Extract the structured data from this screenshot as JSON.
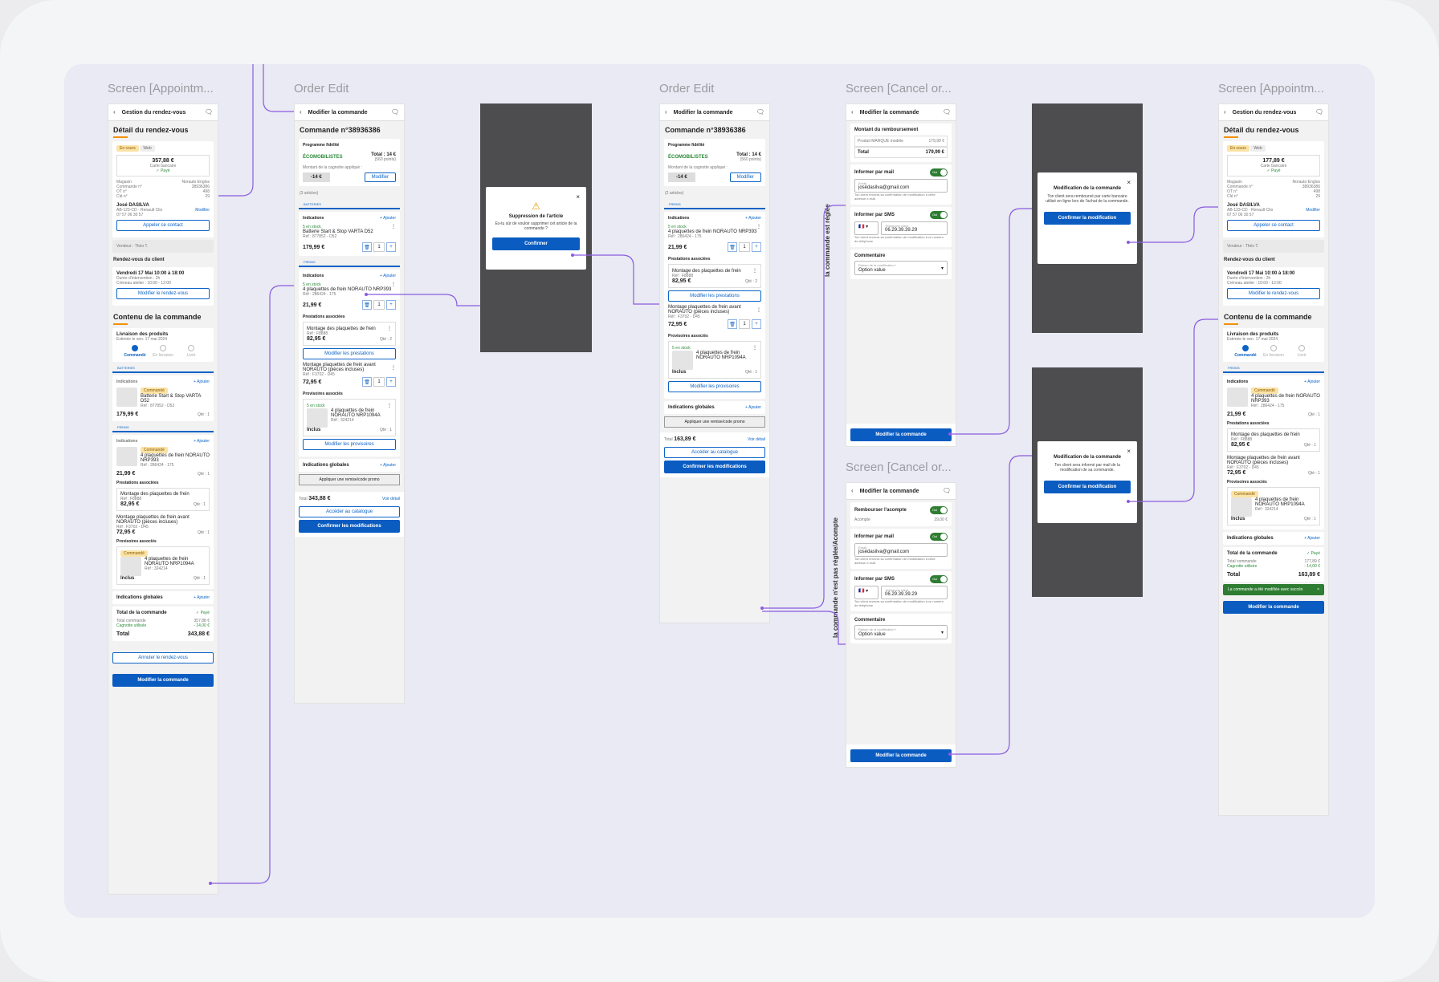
{
  "frames": {
    "s1": "Screen [Appointm...",
    "s2": "Order Edit",
    "s3": "Order Edit",
    "s4": "Screen [Cancel or...",
    "s5": "Screen [Cancel or...",
    "s6": "Screen [Appointm..."
  },
  "flow_labels": {
    "settled": "la commande est réglée",
    "not_settled": "la commande n'est pas réglée/Acompte"
  },
  "appt": {
    "topbar": "Gestion du rendez-vous",
    "detail_title": "Détail du rendez-vous",
    "badge_status": "En cours",
    "badge_channel": "Web",
    "amount": "357,88 €",
    "amount_after": "177,89 €",
    "payment": "Carte bancaire",
    "paid": "✓ Payé",
    "info": [
      {
        "k": "Magasin",
        "v": "Norauto Englos"
      },
      {
        "k": "Commande n°",
        "v": "38936386"
      },
      {
        "k": "OT n°",
        "v": "498"
      },
      {
        "k": "Clé n°",
        "v": "29"
      }
    ],
    "client_name": "José DASILVA",
    "vehicle": "AB-123-CD · Renault Clio",
    "modify": "Modifier",
    "phone": "07 57 06 30 57",
    "call_btn": "Appeler ce contact",
    "seller": "Vendeur : Théo T.",
    "rdv_title": "Rendez-vous du client",
    "rdv_date": "Vendredi 17 Mai 10:00 à 18:00",
    "rdv_duration": "Durée d'intervention : 2h",
    "rdv_slot": "Créneau atelier : 10:00 - 12:00",
    "rdv_btn": "Modifier le rendez-vous",
    "content_title": "Contenu de la commande",
    "delivery_title": "Livraison des produits",
    "delivery_est": "Estimée le ven. 17 mai 2024",
    "steps": [
      "Commandé",
      "En livraison",
      "Livré"
    ],
    "section_batteries": "BATTERIES",
    "section_freins": "FREINS",
    "indications": "Indications",
    "ajouter": "+ Ajouter",
    "ordered_badge": "Commandé",
    "battery_name": "Batterie Start & Stop VARTA D52",
    "battery_ref": "Réf : 877852 - D52",
    "battery_price": "179,99 €",
    "qty1": "Qté : 1",
    "qty2": "Qté : 2",
    "pads_name": "4 plaquettes de frein NORAUTO NRP393",
    "pads_ref": "Réf : 286424 - 175",
    "pads_price": "21,99 €",
    "services_title": "Prestations associées",
    "service1": "Montage des plaquettes de frein",
    "service1_ref": "Réf : F8888",
    "service1_price": "82,95 €",
    "service2": "Montage plaquettes de frein avant NORAUTO (pièces incluses)",
    "service2_ref": "Réf : F3702 - D45",
    "service2_price": "72,95 €",
    "provisional_title": "Provisoires associés",
    "prov_name": "4 plaquettes de frein NORAUTO NRP1094A",
    "prov_ref": "Réf : 324214",
    "included": "Inclus",
    "global_ind": "Indications globales",
    "total_title": "Total de la commande",
    "paid_short": "✓ Payé",
    "total_cmd": "Total commande",
    "total_cmd_v": "357,88 €",
    "total_cmd_v2": "177,89 €",
    "cagnotte": "Cagnotte utilisée",
    "cagnotte_v": "- 14,00 €",
    "total": "Total",
    "total_v": "343,88 €",
    "total_v2": "163,89 €",
    "cancel_btn": "Annuler le rendez-vous",
    "edit_btn": "Modifier la commande",
    "toast": "La commande a été modifiée avec succès"
  },
  "order": {
    "topbar": "Modifier la commande",
    "title": "Commande n°38936386",
    "loyalty": "Programme fidélité",
    "brand": "ÉCOMOBILISTES",
    "loyalty_total": "Total : 14 €",
    "loyalty_points": "(560 points)",
    "cagnotte_label": "Montant de la cagnotte appliqué :",
    "cagnotte_value": "-14 €",
    "modify": "Modifier",
    "articles": "(3 articles)",
    "articles2": "(2 articles)",
    "in_stock": "5 en stock",
    "qty": "1",
    "edit_services": "Modifier les prestations",
    "edit_prov": "Modifier les provisoires",
    "promo": "Appliquer une remise/code promo",
    "total_label": "Total",
    "total_v": "343,88 €",
    "total_v2": "163,89 €",
    "see_detail": "Voir détail",
    "catalog": "Accéder au catalogue",
    "confirm": "Confirmer les modifications"
  },
  "del_modal": {
    "title": "Suppression de l'article",
    "body": "Es-tu sûr de vouloir supprimer cet article de la commande ?",
    "confirm": "Confirmer"
  },
  "cancel": {
    "refund_title": "Montant du remboursement",
    "refund_item": "Produit MARQUE modèle",
    "refund_item_v": "179,99 €",
    "refund_total": "Total",
    "refund_total_v": "179,99 €",
    "acompte_title": "Rembourser l'acompte",
    "acompte": "Acompte",
    "acompte_v": "29,00 €",
    "mail_title": "Informer par mail",
    "on": "Oui",
    "mail_label": "Email",
    "mail_value": "josédasilva@gmail.com",
    "mail_help": "Ton client recevra sa confirmation de modification à cette adresse e-mail",
    "sms_title": "Informer par SMS",
    "sms_label": "Téléphone client",
    "sms_value": "06.29.39.39.29",
    "sms_help": "Ton client recevra sa confirmation de modification à ce numéro de téléphone",
    "comment_title": "Commentaire",
    "reason_label": "Raison de la modification *",
    "reason_value": "Option value",
    "submit": "Modifier la commande"
  },
  "mod_modal": {
    "title": "Modification de la commande",
    "body_card": "Ton client sera remboursé par carte bancaire utilisé en ligne lors de l'achat de la commande.",
    "body_mail": "Ton client sera informé par mail de la modification de sa commande.",
    "confirm": "Confirmer la modification"
  }
}
